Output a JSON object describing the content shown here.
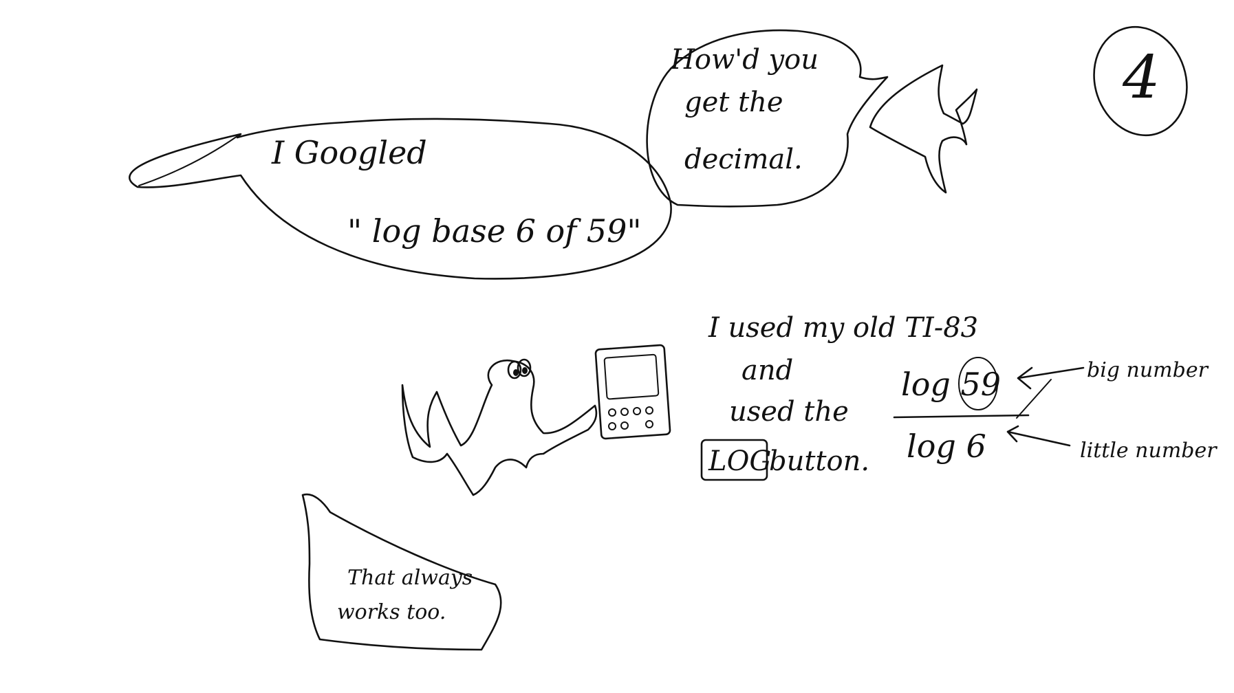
{
  "page": {
    "number": "4"
  },
  "bubble_google": {
    "line1": "I Googled",
    "line2": "\" log base 6 of 59\""
  },
  "bubble_question": {
    "line1": "How'd you",
    "line2": "get the",
    "line3": "decimal."
  },
  "calculator_note": {
    "line1": "I used my old TI-83",
    "line2": "and",
    "line3": "used the",
    "log_key": "LOG",
    "line4": "button."
  },
  "formula": {
    "numerator": "log 59",
    "denominator": "log 6",
    "big_label": "big number",
    "little_label": "little number"
  },
  "bubble_works": {
    "line1": "That always",
    "line2": "works too."
  },
  "colors": {
    "ink": "#111111",
    "paper": "#ffffff"
  },
  "icons": [
    "fish-creature",
    "ghost-creature",
    "calculator"
  ]
}
